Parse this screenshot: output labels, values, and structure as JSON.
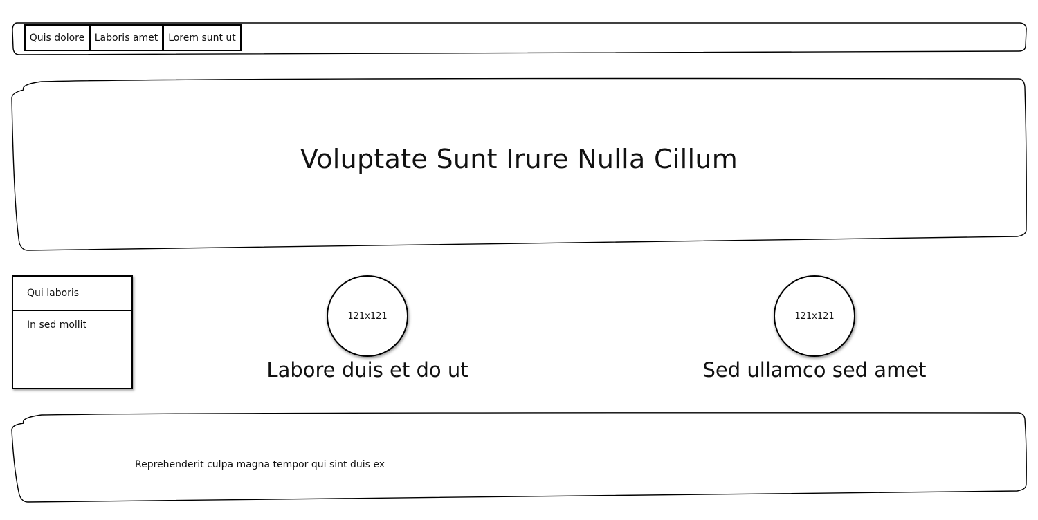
{
  "nav": {
    "tabs": [
      {
        "label": "Quis dolore"
      },
      {
        "label": "Laboris amet"
      },
      {
        "label": "Lorem sunt ut"
      }
    ]
  },
  "hero": {
    "title": "Voluptate Sunt Irure Nulla Cillum"
  },
  "side_list": {
    "items": [
      {
        "label": "Qui laboris"
      },
      {
        "label": "In sed mollit"
      }
    ]
  },
  "cards": [
    {
      "image_placeholder": "121x121",
      "caption": "Labore duis et do ut"
    },
    {
      "image_placeholder": "121x121",
      "caption": "Sed ullamco sed amet"
    }
  ],
  "footer": {
    "text": "Reprehenderit culpa magna tempor qui sint duis ex"
  }
}
